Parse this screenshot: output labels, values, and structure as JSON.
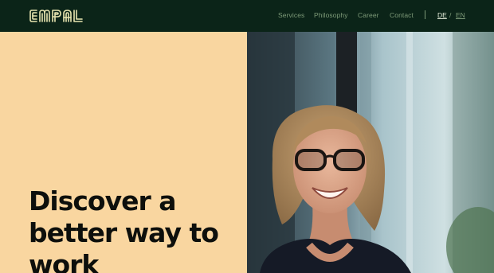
{
  "header": {
    "logo_text": "EMPAL",
    "nav": [
      {
        "label": "Services"
      },
      {
        "label": "Philosophy"
      },
      {
        "label": "Career"
      },
      {
        "label": "Contact"
      }
    ],
    "languages": {
      "active": "DE",
      "separator": "/",
      "inactive": "EN"
    }
  },
  "hero": {
    "headline": "Discover a better way to work"
  },
  "colors": {
    "header_bg": "#0b2418",
    "logo": "#e8e5b0",
    "nav_text": "#7d9a78",
    "hero_bg": "#f9d6a0",
    "headline": "#0d0f0c"
  },
  "icons": {
    "logo": "brand-logo-icon"
  }
}
